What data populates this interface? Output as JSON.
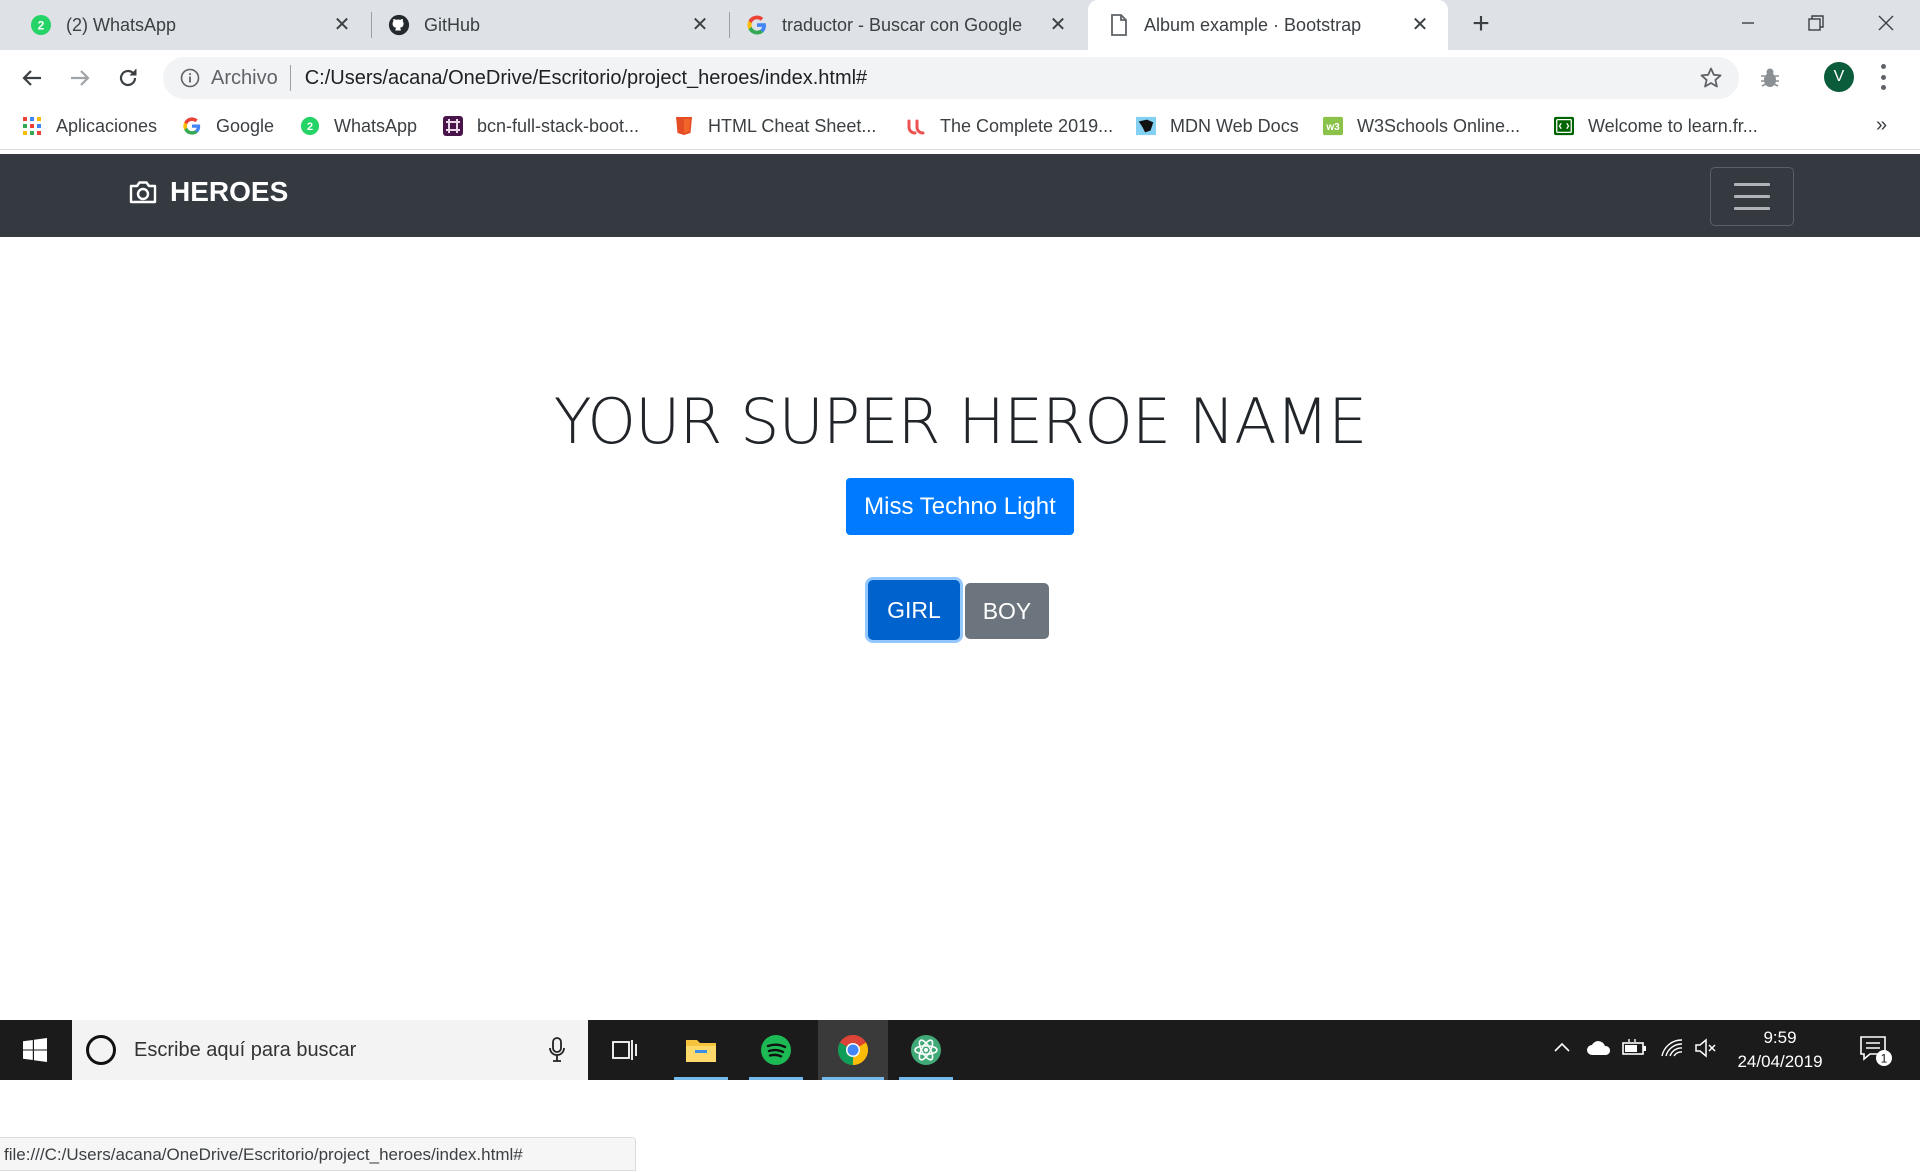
{
  "browser": {
    "tabs": [
      {
        "title": "(2) WhatsApp",
        "favicon": "whatsapp-icon",
        "badge": "2"
      },
      {
        "title": "GitHub",
        "favicon": "github-icon"
      },
      {
        "title": "traductor - Buscar con Google",
        "favicon": "google-icon"
      },
      {
        "title": "Album example · Bootstrap",
        "favicon": "document-icon",
        "active": true
      }
    ],
    "address": {
      "origin_label": "Archivo",
      "url": "C:/Users/acana/OneDrive/Escritorio/project_heroes/index.html#"
    },
    "profile_initial": "V",
    "bookmarks": [
      {
        "label": "Aplicaciones",
        "icon": "apps-grid-icon"
      },
      {
        "label": "Google",
        "icon": "google-icon"
      },
      {
        "label": "WhatsApp",
        "icon": "whatsapp-icon"
      },
      {
        "label": "bcn-full-stack-boot...",
        "icon": "slack-icon"
      },
      {
        "label": "HTML Cheat Sheet...",
        "icon": "html5-icon"
      },
      {
        "label": "The Complete 2019...",
        "icon": "udemy-icon"
      },
      {
        "label": "MDN Web Docs",
        "icon": "mdn-icon"
      },
      {
        "label": "W3Schools Online...",
        "icon": "w3schools-icon"
      },
      {
        "label": "Welcome to learn.fr...",
        "icon": "freecodecamp-icon"
      }
    ],
    "bookmarks_overflow": "»",
    "status_url": "file:///C:/Users/acana/OneDrive/Escritorio/project_heroes/index.html#"
  },
  "page": {
    "brand": "HEROES",
    "hero_title": "YOUR SUPER HEROE NAME",
    "generated_name": "Miss Techno Light",
    "girl_button": "GIRL",
    "boy_button": "BOY",
    "colors": {
      "navbar": "#343a40",
      "primary": "#007bff",
      "secondary": "#6c757d"
    }
  },
  "taskbar": {
    "search_placeholder": "Escribe aquí para buscar",
    "time": "9:59",
    "date": "24/04/2019",
    "notification_count": "1",
    "apps": [
      "task-view-icon",
      "file-explorer-icon",
      "spotify-icon",
      "chrome-icon",
      "atom-icon"
    ]
  }
}
